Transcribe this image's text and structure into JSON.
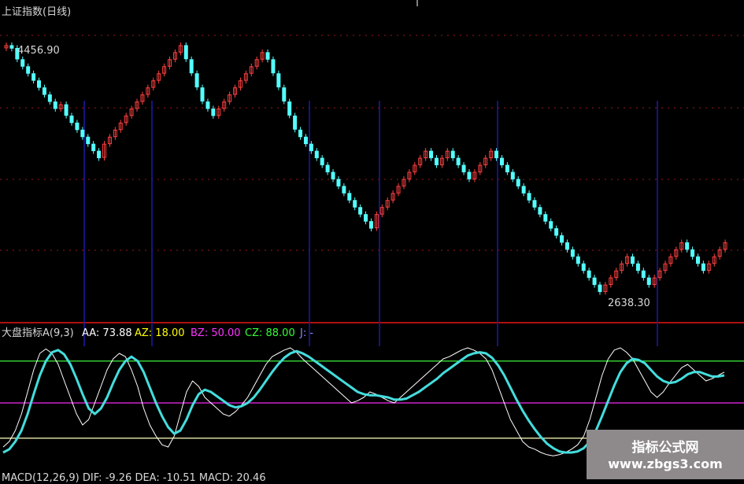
{
  "price_panel": {
    "title": "上证指数(日线)",
    "high_label": "4456.90",
    "low_label": "2638.30"
  },
  "indicator_panel": {
    "name": "大盘指标A(9,3)",
    "aa": "AA: 73.88",
    "az": "AZ: 18.00",
    "bz": "BZ: 50.00",
    "cz": "CZ: 88.00",
    "j": "J: -",
    "macd_row": "MACD(12,26,9)  DIF: -9.26  DEA: -10.51  MACD: 20.46"
  },
  "watermark": {
    "line1": "指标公式网",
    "line2": "www.zbgs3.com"
  },
  "colors": {
    "background": "#000000",
    "up_candle": "#ff4040",
    "down_candle": "#54ffff",
    "signal_line": "#1a1aa8",
    "grid_dotted": "#a01818",
    "separator": "#b01010",
    "cz_line": "#33cc33",
    "bz_line": "#cc22cc",
    "az_line": "#d8d8a0",
    "k_line": "#ffffff",
    "d_line": "#44dddd",
    "label_yellow": "#ffff00",
    "label_magenta": "#ff33ff",
    "label_green": "#33ff33"
  },
  "chart_data": [
    {
      "type": "candlestick",
      "title": "上证指数(日线)",
      "annotations": [
        "4456.90",
        "2638.30"
      ],
      "series": [
        {
          "values": [
            4400,
            4380,
            4300,
            4250,
            4200,
            4150,
            4100,
            4050,
            4000,
            3950,
            3980,
            3900,
            3850,
            3800,
            3750,
            3700,
            3650,
            3600,
            3700,
            3750,
            3800,
            3850,
            3900,
            3950,
            4000,
            4050,
            4100,
            4150,
            4200,
            4250,
            4300,
            4350,
            4400,
            4300,
            4200,
            4100,
            4000,
            3950,
            3900,
            3950,
            4000,
            4050,
            4100,
            4150,
            4200,
            4250,
            4300,
            4350,
            4300,
            4200,
            4100,
            4000,
            3900,
            3800,
            3750,
            3700,
            3650,
            3600,
            3550,
            3500,
            3450,
            3400,
            3350,
            3300,
            3250,
            3200,
            3150,
            3100,
            3200,
            3250,
            3300,
            3350,
            3400,
            3450,
            3500,
            3550,
            3600,
            3650,
            3600,
            3550,
            3600,
            3650,
            3600,
            3550,
            3500,
            3450,
            3500,
            3550,
            3600,
            3650,
            3600,
            3550,
            3500,
            3450,
            3400,
            3350,
            3300,
            3250,
            3200,
            3150,
            3100,
            3050,
            3000,
            2950,
            2900,
            2850,
            2800,
            2750,
            2700,
            2650,
            2700,
            2750,
            2800,
            2850,
            2900,
            2850,
            2800,
            2750,
            2700,
            2750,
            2800,
            2850,
            2900,
            2950,
            3000,
            2950,
            2900,
            2850,
            2800,
            2850,
            2900,
            2950,
            3000
          ]
        }
      ]
    },
    {
      "type": "line",
      "title": "大盘指标A(9,3)",
      "ylim": [
        0,
        100
      ],
      "reference_lines": [
        {
          "name": "CZ",
          "value": 88
        },
        {
          "name": "BZ",
          "value": 50
        },
        {
          "name": "AZ",
          "value": 18
        }
      ],
      "series": [
        {
          "name": "K",
          "values": [
            10,
            15,
            25,
            40,
            60,
            80,
            95,
            99,
            95,
            85,
            70,
            55,
            40,
            30,
            35,
            50,
            65,
            80,
            90,
            95,
            92,
            80,
            65,
            45,
            30,
            20,
            12,
            10,
            20,
            40,
            60,
            70,
            65,
            55,
            50,
            45,
            40,
            38,
            42,
            48,
            55,
            65,
            75,
            85,
            92,
            95,
            98,
            100,
            96,
            90,
            85,
            80,
            75,
            70,
            65,
            60,
            55,
            50,
            52,
            55,
            60,
            58,
            55,
            52,
            50,
            55,
            60,
            65,
            70,
            75,
            80,
            85,
            90,
            92,
            95,
            98,
            100,
            98,
            95,
            90,
            80,
            65,
            50,
            35,
            25,
            15,
            10,
            8,
            5,
            3,
            2,
            3,
            5,
            8,
            12,
            20,
            35,
            55,
            75,
            90,
            98,
            100,
            96,
            90,
            80,
            70,
            60,
            55,
            60,
            68,
            75,
            82,
            85,
            80,
            75,
            70,
            72,
            75,
            78
          ]
        },
        {
          "name": "D",
          "values": [
            5,
            8,
            15,
            25,
            40,
            58,
            75,
            88,
            96,
            98,
            94,
            85,
            72,
            58,
            45,
            40,
            45,
            55,
            68,
            80,
            88,
            92,
            88,
            78,
            64,
            50,
            38,
            28,
            22,
            25,
            35,
            48,
            58,
            62,
            60,
            56,
            52,
            48,
            46,
            47,
            50,
            55,
            62,
            70,
            78,
            85,
            91,
            95,
            97,
            95,
            92,
            88,
            84,
            80,
            76,
            72,
            68,
            64,
            60,
            58,
            57,
            57,
            56,
            55,
            53,
            53,
            54,
            57,
            60,
            64,
            68,
            72,
            77,
            81,
            85,
            89,
            93,
            95,
            96,
            95,
            91,
            84,
            75,
            64,
            53,
            43,
            34,
            26,
            19,
            13,
            9,
            6,
            5,
            5,
            6,
            9,
            15,
            25,
            38,
            52,
            66,
            78,
            86,
            90,
            89,
            86,
            80,
            74,
            70,
            68,
            69,
            72,
            76,
            78,
            78,
            76,
            74,
            74,
            75
          ]
        }
      ]
    }
  ]
}
